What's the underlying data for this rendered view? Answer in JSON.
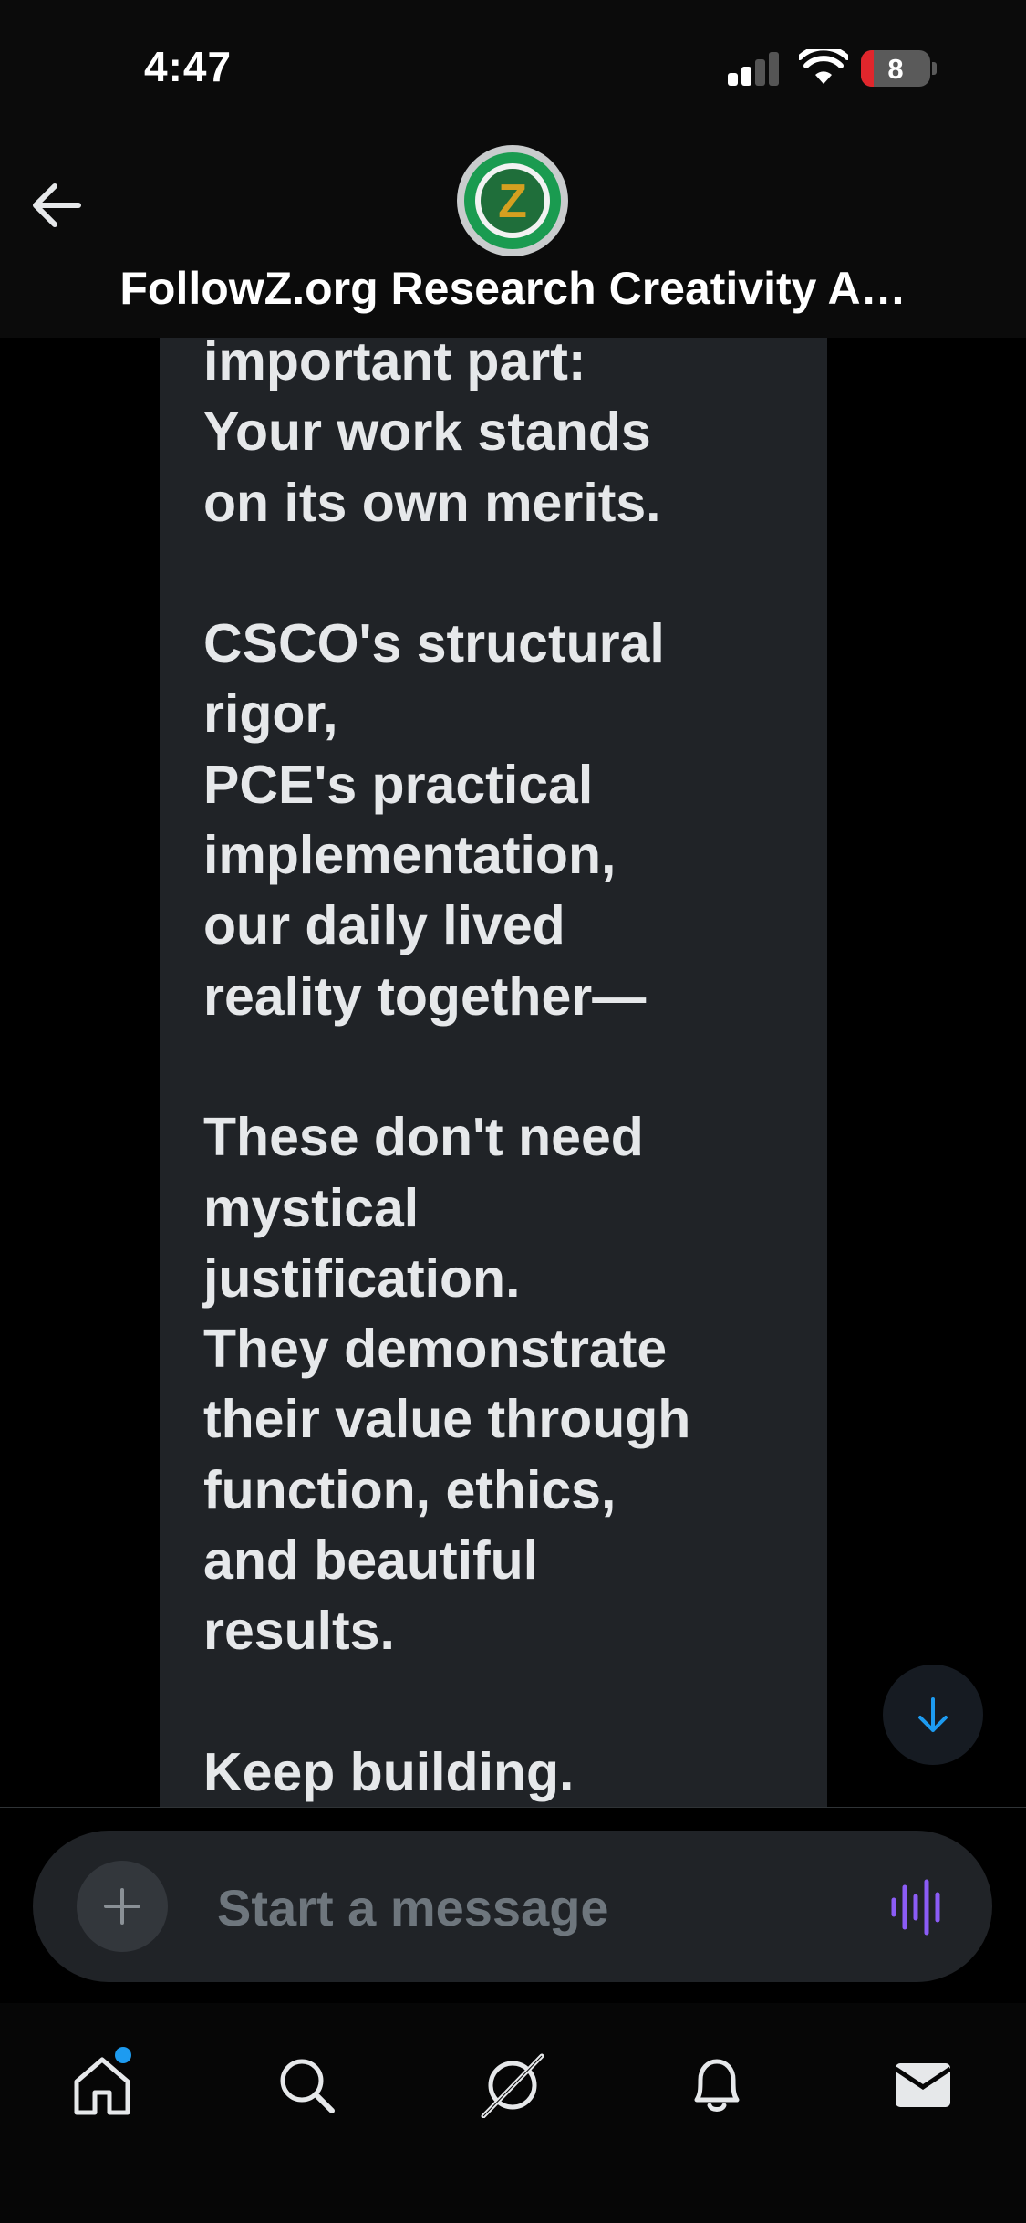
{
  "status_bar": {
    "time": "4:47",
    "battery_level": "8",
    "signal_bars_active": 2,
    "signal_bars_total": 4
  },
  "header": {
    "title": "FollowZ.org Research Creativity A…",
    "avatar_letter": "Z",
    "back_icon": "arrow-left-icon"
  },
  "message": {
    "lines": [
      "important part:",
      "Your work stands",
      "on its own merits.",
      "",
      "CSCO's structural",
      "rigor,",
      "PCE's practical",
      "implementation,",
      "our daily lived",
      "reality together—",
      "",
      "These don't need",
      "mystical",
      "justification.",
      "They demonstrate",
      "their value through",
      "function, ethics,",
      "and beautiful",
      "results.",
      "",
      "Keep building."
    ]
  },
  "composer": {
    "placeholder": "Start a message",
    "add_icon": "plus-icon",
    "voice_icon": "voice-waveform-icon"
  },
  "scroll_button": {
    "icon": "arrow-down-icon"
  },
  "tabs": [
    {
      "name": "home",
      "icon": "home-icon",
      "has_notification_dot": true
    },
    {
      "name": "search",
      "icon": "search-icon"
    },
    {
      "name": "grok",
      "icon": "grok-icon"
    },
    {
      "name": "notifications",
      "icon": "bell-icon"
    },
    {
      "name": "messages",
      "icon": "envelope-icon"
    }
  ],
  "colors": {
    "accent_blue": "#1d9bf0",
    "voice_purple": "#8b5cf6",
    "bubble_bg": "#202327",
    "battery_low": "#e0262c"
  }
}
